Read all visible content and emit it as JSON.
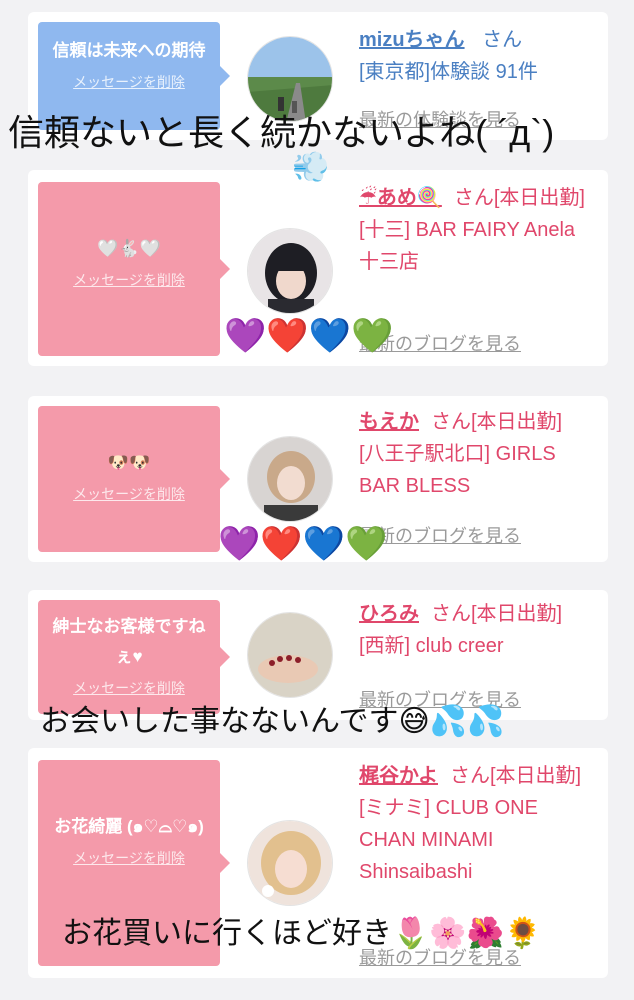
{
  "cards": [
    {
      "message": "信頼は未来への期待",
      "delete_label": "メッセージを削除",
      "name": "mizuちゃん",
      "suffix": "さん",
      "area_line": "[東京都]体験談 91件",
      "blog_label": "最新の体験談を見る",
      "color": "#8fb8ef"
    },
    {
      "message": "🤍🐇🤍",
      "delete_label": "メッセージを削除",
      "name": "☔あめ🍭",
      "suffix": "さん[本日出勤]",
      "area_line": "[十三] BAR FAIRY Anela 十三店",
      "blog_label": "最新のブログを見る",
      "color": "#f49aaa"
    },
    {
      "message": "🐶🐶",
      "delete_label": "メッセージを削除",
      "name": "もえか",
      "suffix": "さん[本日出勤]",
      "area_line": "[八王子駅北口] GIRLS BAR BLESS",
      "blog_label": "最新のブログを見る",
      "color": "#f49aaa"
    },
    {
      "message": "紳士なお客様ですねぇ♥",
      "delete_label": "メッセージを削除",
      "name": "ひろみ",
      "suffix": "さん[本日出勤]",
      "area_line": "[西新] club creer",
      "blog_label": "最新のブログを見る",
      "color": "#f49aaa"
    },
    {
      "message": "お花綺麗 (๑♡⌓♡๑)",
      "delete_label": "メッセージを削除",
      "name": "梶谷かよ",
      "suffix": "さん[本日出勤]",
      "area_line": "[ミナミ] CLUB ONE CHAN MINAMI Shinsaibashi",
      "blog_label": "最新のブログを見る",
      "color": "#f49aaa"
    }
  ],
  "overlays": {
    "text1": "信頼ないと長く続かないよね( ´д`)",
    "emoji1": "💨",
    "hearts": "💜❤️💙💚",
    "text2": "お会いした事なないんです😅💦💦",
    "text3": "お花買いに行くほど好き🌷🌸🌺🌻"
  },
  "colors": {
    "blue_accent": "#4a7fc2",
    "pink_accent": "#e0476b",
    "blue_bubble": "#8fb8ef",
    "pink_bubble": "#f49aaa"
  }
}
